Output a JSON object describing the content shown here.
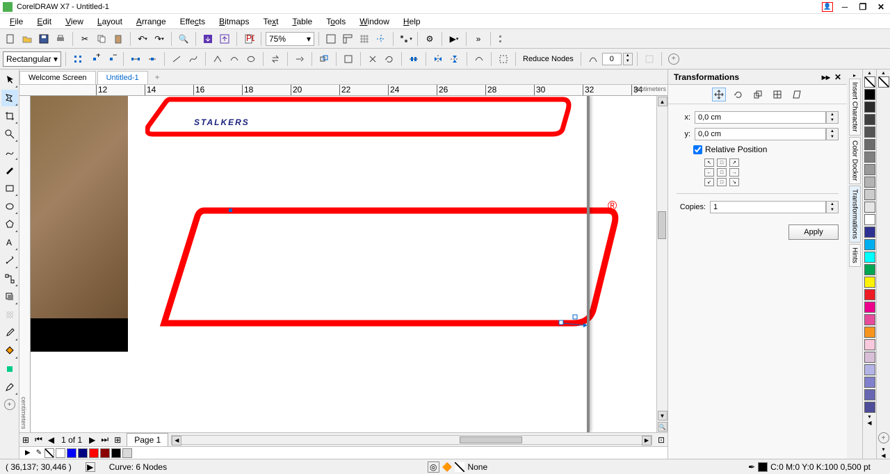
{
  "app": {
    "title": "CorelDRAW X7 - Untitled-1"
  },
  "menu": {
    "items": [
      "File",
      "Edit",
      "View",
      "Layout",
      "Arrange",
      "Effects",
      "Bitmaps",
      "Text",
      "Table",
      "Tools",
      "Window",
      "Help"
    ]
  },
  "toolbar": {
    "zoom": "75%"
  },
  "propbar": {
    "shape_label": "Rectangular",
    "reduce_label": "Reduce Nodes",
    "curve_smooth": "0"
  },
  "tabs": {
    "items": [
      "Welcome Screen",
      "Untitled-1"
    ],
    "active": 1
  },
  "ruler": {
    "unit_label": "centimeters",
    "ticks": [
      "12",
      "14",
      "16",
      "18",
      "20",
      "22",
      "24",
      "26",
      "28",
      "30",
      "32",
      "34"
    ]
  },
  "docker": {
    "title": "Transformations",
    "x_label": "x:",
    "y_label": "y:",
    "x_val": "0,0 cm",
    "y_val": "0,0 cm",
    "relpos_label": "Relative Position",
    "copies_label": "Copies:",
    "copies_val": "1",
    "apply_label": "Apply"
  },
  "vert_tabs": [
    "Insert Character",
    "Color Docker",
    "Transformations",
    "Hints"
  ],
  "page_nav": {
    "counter": "1 of 1",
    "page_label": "Page 1"
  },
  "color_strip": [
    "none",
    "#ffffff",
    "#0000ff",
    "#000080",
    "#ff0000",
    "#800000",
    "#000000",
    "#d9d9d9"
  ],
  "status": {
    "coords": "( 36,137; 30,446 )",
    "object_info": "Curve: 6 Nodes",
    "fill_label": "None",
    "outline_label": "C:0 M:0 Y:0 K:100  0,500 pt"
  },
  "right_palette": {
    "top": [
      "none",
      "none",
      "#000000",
      "#333333",
      "#4d4d4d",
      "#666666",
      "#808080",
      "#999999",
      "#b3b3b3",
      "#cccccc",
      "#e6e6e6",
      "#f2f2f2",
      "#ffffff"
    ],
    "row2": [
      "#3f51b5",
      "#00bcd4",
      "#00ffff",
      "#00e676",
      "#ffeb3b",
      "#ff0000",
      "#e91e63",
      "#e91e63",
      "#ff9800",
      "#f8bbd0",
      "#ce93d8",
      "#b39ddb",
      "#7986cb",
      "#5c6bc0",
      "#3f51b5",
      "#283593"
    ]
  }
}
